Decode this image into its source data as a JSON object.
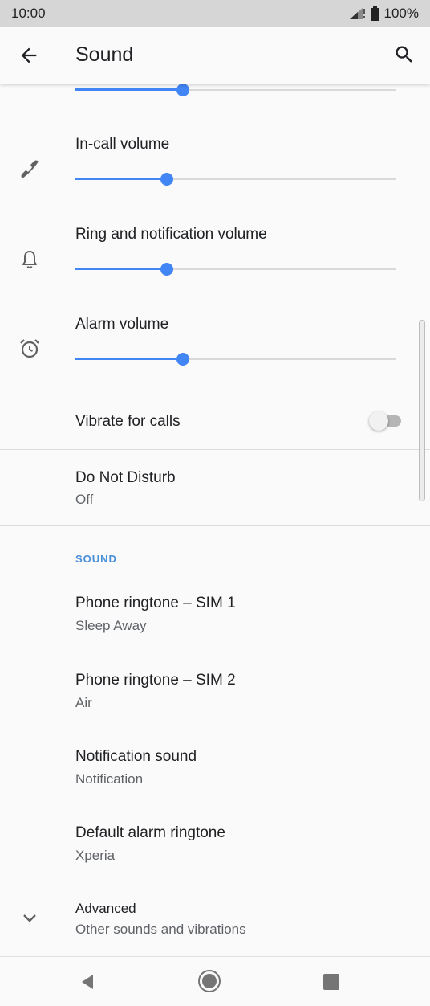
{
  "status_bar": {
    "time": "10:00",
    "battery": "100%"
  },
  "app_bar": {
    "title": "Sound"
  },
  "media_volume": {
    "level_percent": 33.5
  },
  "in_call_volume": {
    "label": "In-call volume",
    "level_percent": 28.5
  },
  "ring_volume": {
    "label": "Ring and notification volume",
    "level_percent": 28.5
  },
  "alarm_volume": {
    "label": "Alarm volume",
    "level_percent": 33.5
  },
  "vibrate_for_calls": {
    "label": "Vibrate for calls",
    "enabled": false
  },
  "do_not_disturb": {
    "label": "Do Not Disturb",
    "value": "Off"
  },
  "sound_section": {
    "header": "SOUND",
    "items": [
      {
        "label": "Phone ringtone – SIM 1",
        "value": "Sleep Away"
      },
      {
        "label": "Phone ringtone – SIM 2",
        "value": "Air"
      },
      {
        "label": "Notification sound",
        "value": "Notification"
      },
      {
        "label": "Default alarm ringtone",
        "value": "Xperia"
      }
    ]
  },
  "advanced": {
    "label": "Advanced",
    "value": "Other sounds and vibrations"
  },
  "colors": {
    "accent": "#4285f4",
    "section_header": "#4a90d9",
    "background": "#fafafa"
  }
}
